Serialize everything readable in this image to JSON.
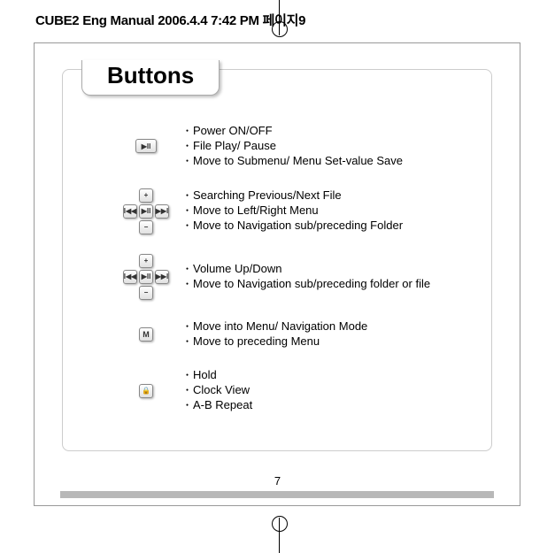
{
  "header": "CUBE2 Eng Manual  2006.4.4  7:42 PM  페이지9",
  "title": "Buttons",
  "rows": [
    {
      "items": [
        "Power ON/OFF",
        "File Play/ Pause",
        "Move to Submenu/ Menu Set-value Save"
      ]
    },
    {
      "items": [
        "Searching Previous/Next File",
        "Move to Left/Right Menu",
        "Move to Navigation sub/preceding Folder"
      ]
    },
    {
      "items": [
        "Volume Up/Down",
        "Move to Navigation sub/preceding folder or file"
      ]
    },
    {
      "items": [
        "Move into Menu/ Navigation Mode",
        "Move to preceding Menu"
      ]
    },
    {
      "items": [
        "Hold",
        "Clock View",
        "A-B Repeat"
      ]
    }
  ],
  "pageNumber": "7"
}
